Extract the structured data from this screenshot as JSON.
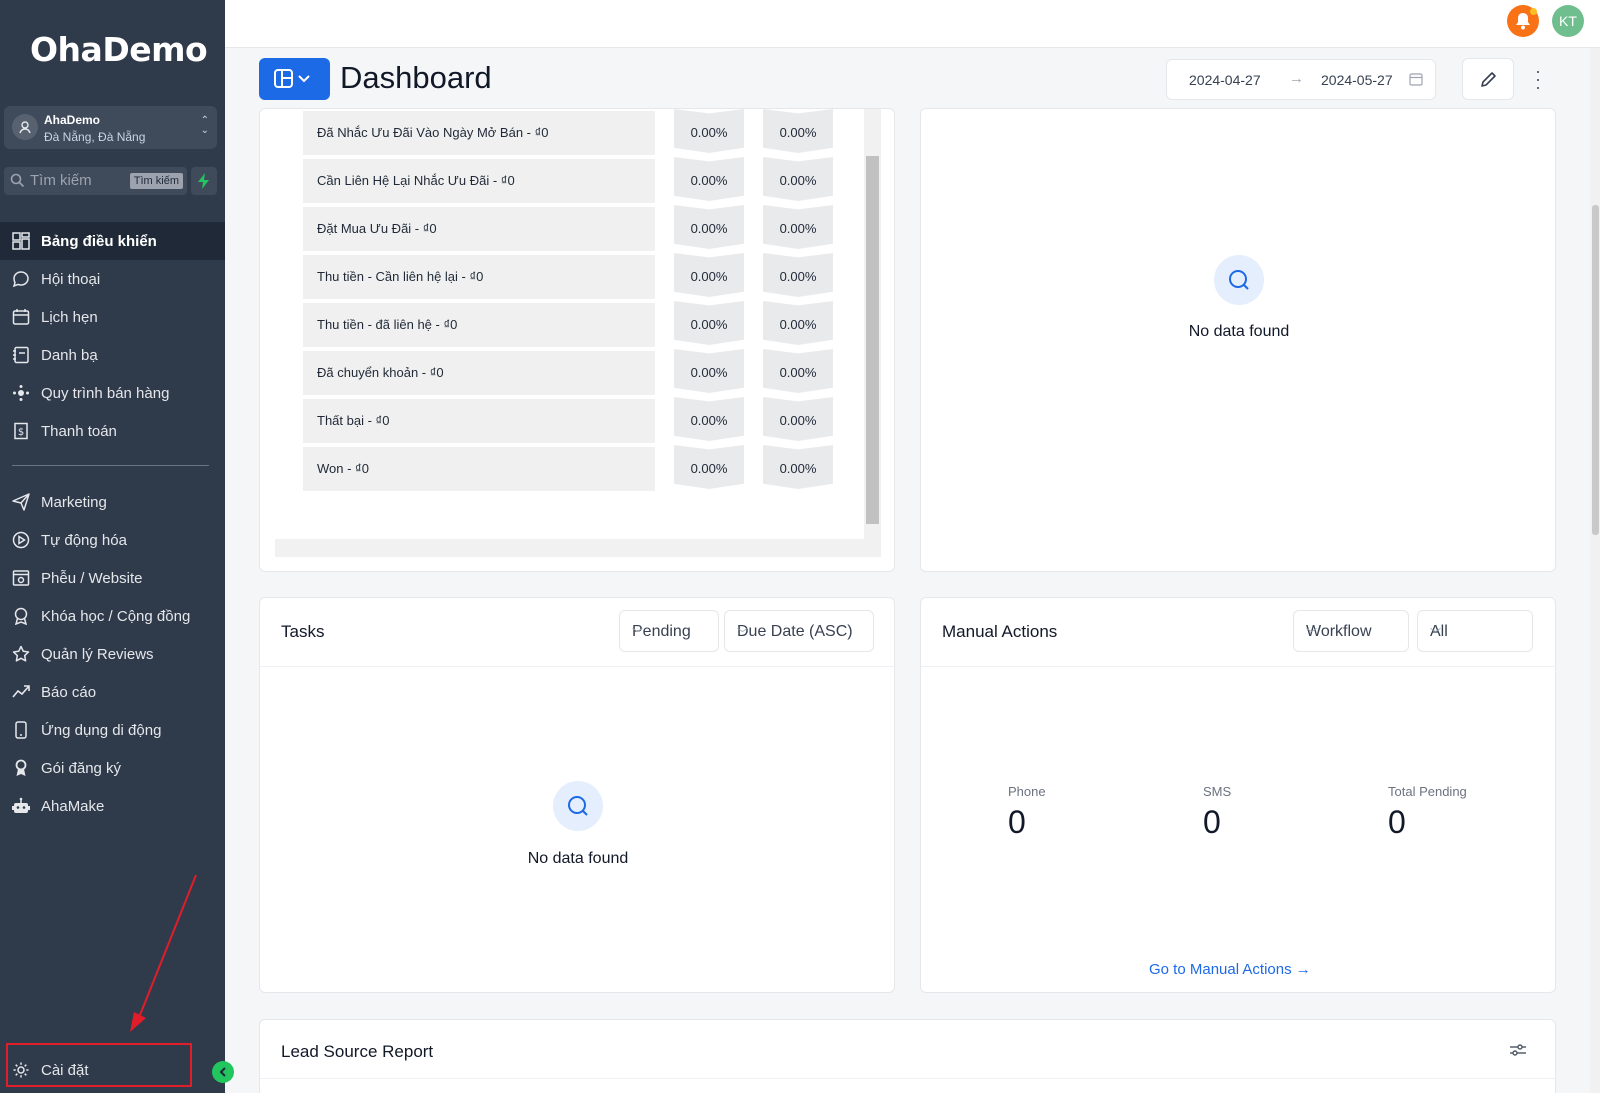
{
  "brand": {
    "logo": "OhaDemo"
  },
  "account": {
    "name": "AhaDemo",
    "location": "Đà Nẵng, Đà Nẵng"
  },
  "search": {
    "placeholder": "Tìm kiếm",
    "shortcut": "Tìm kiếm"
  },
  "nav": {
    "main": [
      {
        "label": "Bảng điều khiển",
        "icon": "dashboard-icon",
        "active": true
      },
      {
        "label": "Hội thoại",
        "icon": "chat-icon"
      },
      {
        "label": "Lịch hẹn",
        "icon": "calendar-icon"
      },
      {
        "label": "Danh bạ",
        "icon": "contacts-icon"
      },
      {
        "label": "Quy trình bán hàng",
        "icon": "pipeline-icon"
      },
      {
        "label": "Thanh toán",
        "icon": "payment-icon"
      }
    ],
    "secondary": [
      {
        "label": "Marketing",
        "icon": "send-icon"
      },
      {
        "label": "Tự động hóa",
        "icon": "automation-icon"
      },
      {
        "label": "Phễu / Website",
        "icon": "funnel-icon"
      },
      {
        "label": "Khóa học / Cộng đồng",
        "icon": "award-icon"
      },
      {
        "label": "Quản lý Reviews",
        "icon": "star-icon"
      },
      {
        "label": "Báo cáo",
        "icon": "chart-icon"
      },
      {
        "label": "Ứng dụng di động",
        "icon": "mobile-icon"
      },
      {
        "label": "Gói đăng ký",
        "icon": "badge-icon"
      },
      {
        "label": "AhaMake",
        "icon": "robot-icon"
      }
    ],
    "settings": {
      "label": "Cài đặt",
      "icon": "gear-icon"
    }
  },
  "topbar": {
    "avatar": "KT"
  },
  "header": {
    "title": "Dashboard",
    "date_start": "2024-04-27",
    "date_arrow": "→",
    "date_end": "2024-05-27"
  },
  "pipeline": {
    "rows": [
      {
        "stage": "Đã Nhắc Ưu Đãi Vào Ngày Mở Bán - ₫0",
        "pct1": "0.00%",
        "pct2": "0.00%"
      },
      {
        "stage": "Cần Liên Hệ Lại Nhắc Ưu Đãi - ₫0",
        "pct1": "0.00%",
        "pct2": "0.00%"
      },
      {
        "stage": "Đặt Mua Ưu Đãi - ₫0",
        "pct1": "0.00%",
        "pct2": "0.00%"
      },
      {
        "stage": "Thu tiền - Cần liên hệ lại - ₫0",
        "pct1": "0.00%",
        "pct2": "0.00%"
      },
      {
        "stage": "Thu tiền - đã liên hệ - ₫0",
        "pct1": "0.00%",
        "pct2": "0.00%"
      },
      {
        "stage": "Đã chuyển khoản - ₫0",
        "pct1": "0.00%",
        "pct2": "0.00%"
      },
      {
        "stage": "Thất bại - ₫0",
        "pct1": "0.00%",
        "pct2": "0.00%"
      },
      {
        "stage": "Won - ₫0",
        "pct1": "0.00%",
        "pct2": "0.00%"
      }
    ]
  },
  "right_top": {
    "empty": "No data found"
  },
  "tasks": {
    "title": "Tasks",
    "status_filter": "Pending",
    "sort_filter": "Due Date (ASC)",
    "empty": "No data found"
  },
  "manual_actions": {
    "title": "Manual Actions",
    "workflow_filter": "Workflow",
    "scope_filter": "All",
    "stats": [
      {
        "label": "Phone",
        "value": "0"
      },
      {
        "label": "SMS",
        "value": "0"
      },
      {
        "label": "Total Pending",
        "value": "0"
      }
    ],
    "link": "Go to Manual Actions →"
  },
  "lead_source": {
    "title": "Lead Source Report"
  },
  "colors": {
    "sidebar": "#2f3a4a",
    "accent": "#1d6ae6",
    "highlight": "#e11d2a",
    "success": "#22c55e",
    "notify": "#f97316"
  }
}
